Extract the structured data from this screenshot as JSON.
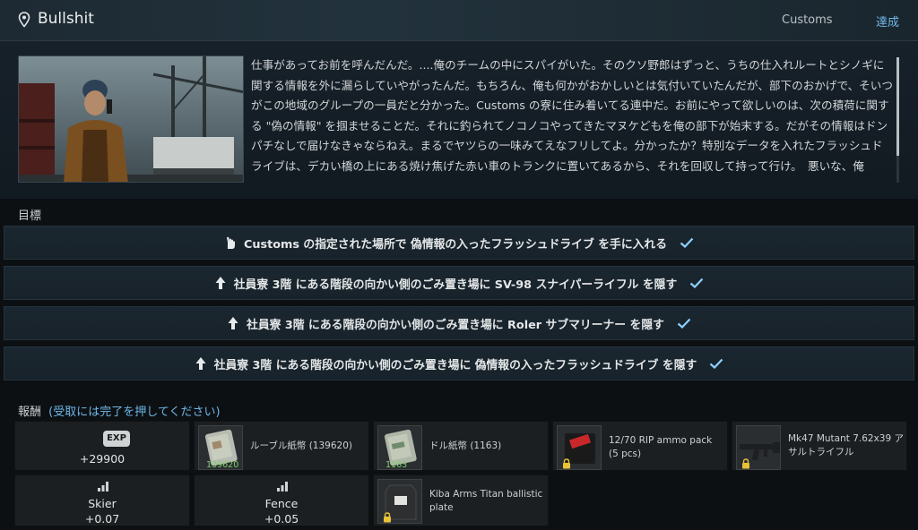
{
  "header": {
    "title": "Bullshit",
    "location": "Customs",
    "status": "達成"
  },
  "description": {
    "text": "仕事があってお前を呼んだんだ。....俺のチームの中にスパイがいた。そのクソ野郎はずっと、うちの仕入れルートとシノギに関する情報を外に漏らしていやがったんだ。もちろん、俺も何かがおかしいとは気付いていたんだが、部下のおかげで、そいつがこの地域のグループの一員だと分かった。Customs の寮に住み着いてる連中だ。お前にやって欲しいのは、次の積荷に関する \"偽の情報\" を掴ませることだ。それに釣られてノコノコやってきたマヌケどもを俺の部下が始末する。だがその情報はドンパチなしで届けなきゃならねえ。まるでヤツらの一味みてえなフリしてよ。分かったか？特別なデータを入れたフラッシュドライブは、デカい橋の上にある焼け焦げた赤い車のトランクに置いてあるから、それを回収して持って行け。　悪いな、俺"
  },
  "objectives": {
    "label": "目標",
    "items": [
      {
        "text": "Customs の指定された場所で 偽情報の入ったフラッシュドライブ を手に入れる",
        "icon": "hand-pickup-icon"
      },
      {
        "text": "社員寮 3階 にある階段の向かい側のごみ置き場に SV-98 スナイパーライフル を隠す",
        "icon": "stash-arrow-icon"
      },
      {
        "text": "社員寮 3階 にある階段の向かい側のごみ置き場に Roler サブマリーナー を隠す",
        "icon": "stash-arrow-icon"
      },
      {
        "text": "社員寮 3階 にある階段の向かい側のごみ置き場に 偽情報の入ったフラッシュドライブ を隠す",
        "icon": "stash-arrow-icon"
      }
    ]
  },
  "rewards": {
    "label": "報酬",
    "hint": "(受取には完了を押してください)",
    "exp": {
      "badge": "EXP",
      "value": "+29900"
    },
    "items": [
      {
        "name": "ルーブル紙幣 (139620)",
        "qty": "139620",
        "locked": false,
        "icon": "rouble-cash-icon"
      },
      {
        "name": "ドル紙幣 (1163)",
        "qty": "1163",
        "locked": false,
        "icon": "dollar-cash-icon"
      },
      {
        "name": "12/70 RIP ammo pack (5 pcs)",
        "qty": "",
        "locked": true,
        "icon": "ammo-pack-icon"
      },
      {
        "name": "Mk47 Mutant 7.62x39 アサルトライフル",
        "qty": "",
        "locked": true,
        "icon": "rifle-icon"
      },
      {
        "name": "Kiba Arms Titan ballistic plate",
        "qty": "",
        "locked": true,
        "icon": "ballistic-plate-icon"
      }
    ],
    "standing": [
      {
        "trader": "Skier",
        "value": "+0.07"
      },
      {
        "trader": "Fence",
        "value": "+0.05"
      }
    ]
  },
  "colors": {
    "accent": "#6fb6e6",
    "check": "#8ed0ff",
    "cell_bg": "#1c1f21"
  }
}
